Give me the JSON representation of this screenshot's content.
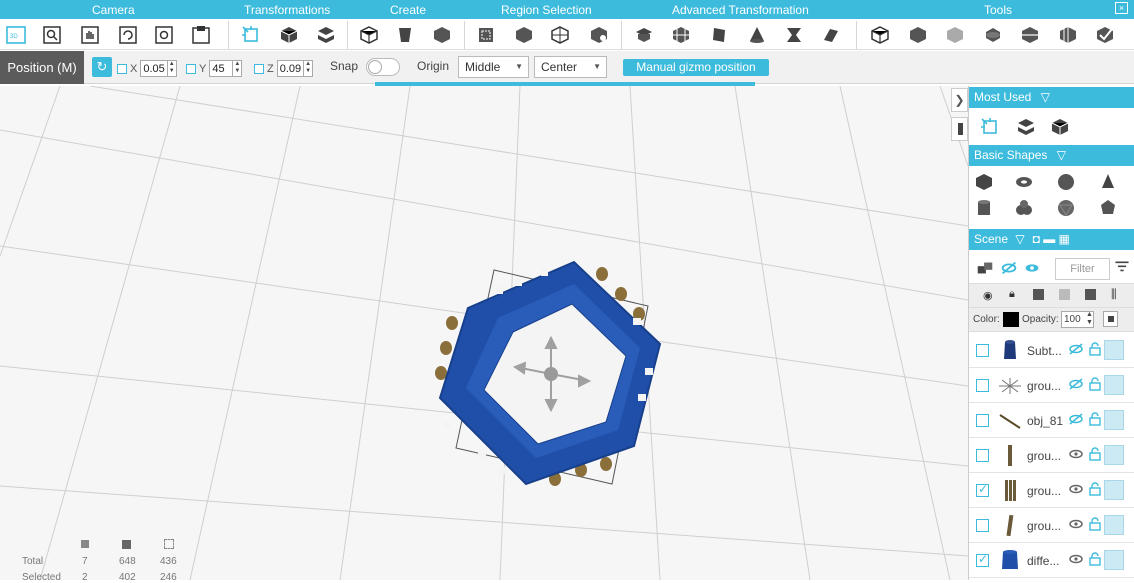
{
  "ribbon": {
    "groups": [
      "Camera",
      "Transformations",
      "Create",
      "Region Selection",
      "Advanced Transformation",
      "Tools"
    ],
    "close_label": "×"
  },
  "options": {
    "mode_label": "Position (M)",
    "x_label": "X",
    "x_value": "0.05",
    "y_label": "Y",
    "y_value": "45",
    "z_label": "Z",
    "z_value": "0.09",
    "snap_label": "Snap",
    "origin_label": "Origin",
    "origin_value": "Middle",
    "align_value": "Center",
    "gizmo_button": "Manual gizmo position"
  },
  "stats": {
    "total_label": "Total",
    "selected_label": "Selected",
    "total": [
      "7",
      "648",
      "436"
    ],
    "selected": [
      "2",
      "402",
      "246"
    ]
  },
  "panel": {
    "most_used": "Most Used",
    "basic_shapes": "Basic Shapes",
    "scene": "Scene",
    "filter_placeholder": "Filter",
    "color_label": "Color:",
    "opacity_label": "Opacity:",
    "opacity_value": "100",
    "items": [
      {
        "name": "Subt...",
        "checked": false,
        "visible_icon": "eye-slash"
      },
      {
        "name": "grou...",
        "checked": false,
        "visible_icon": "eye-slash"
      },
      {
        "name": "obj_81",
        "checked": false,
        "visible_icon": "eye-slash"
      },
      {
        "name": "grou...",
        "checked": false,
        "visible_icon": "eye"
      },
      {
        "name": "grou...",
        "checked": true,
        "visible_icon": "eye"
      },
      {
        "name": "grou...",
        "checked": false,
        "visible_icon": "eye"
      },
      {
        "name": "diffe...",
        "checked": true,
        "visible_icon": "eye"
      }
    ]
  },
  "colors": {
    "accent": "#3cbbdc",
    "model_blue": "#1f4fa8",
    "peg": "#8a6f3a"
  }
}
